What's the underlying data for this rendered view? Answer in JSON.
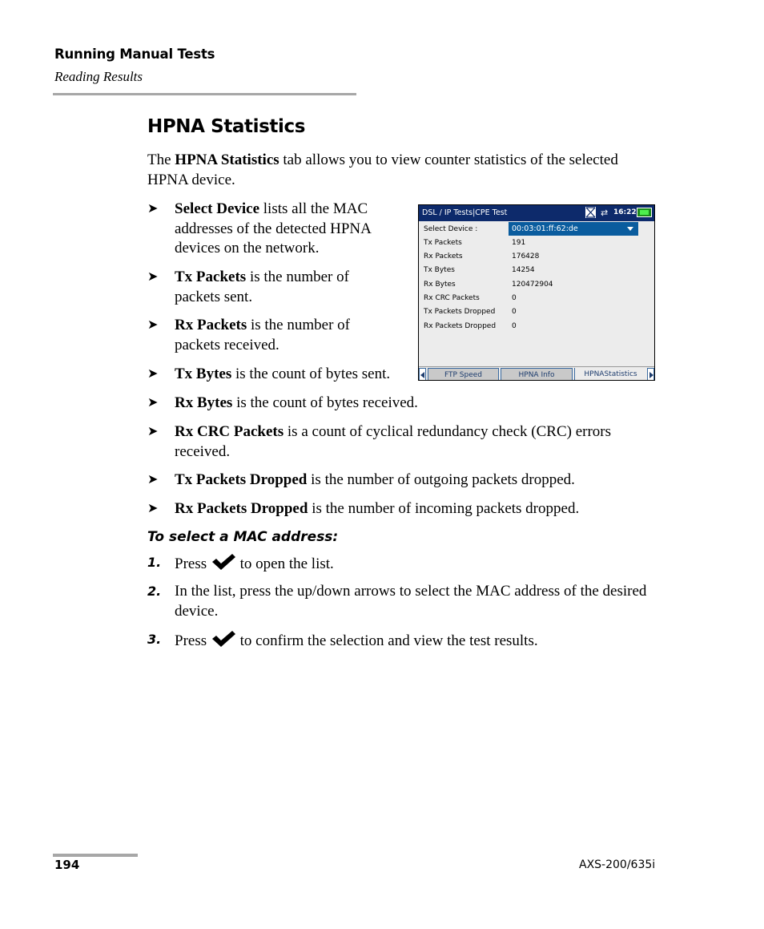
{
  "header": {
    "chapter": "Running Manual Tests",
    "section": "Reading Results"
  },
  "section_title": "HPNA Statistics",
  "intro": {
    "pre": "The ",
    "bold": "HPNA Statistics",
    "post": " tab allows you to view counter statistics of the selected HPNA device."
  },
  "bullets": [
    {
      "term": "Select Device",
      "text": " lists all the MAC addresses of the detected HPNA devices on the network."
    },
    {
      "term": "Tx Packets",
      "text": " is the number of packets sent."
    },
    {
      "term": "Rx Packets",
      "text": " is the number of packets received."
    },
    {
      "term": "Tx Bytes",
      "text": " is the count of bytes sent."
    },
    {
      "term": "Rx Bytes",
      "text": " is the count of bytes received."
    },
    {
      "term": "Rx CRC Packets",
      "text": " is a count of cyclical redundancy check (CRC) errors received."
    },
    {
      "term": "Tx Packets Dropped",
      "text": " is the number of outgoing packets dropped."
    },
    {
      "term": "Rx Packets Dropped",
      "text": " is the number of incoming packets dropped."
    }
  ],
  "bullet_glyph": "➤",
  "procedure": {
    "title": "To select a MAC address:",
    "steps": [
      {
        "num": "1.",
        "pre": "Press ",
        "icon": "checkmark-icon",
        "post": " to open the list."
      },
      {
        "num": "2.",
        "text": "In the list, press the up/down arrows to select the MAC address of the desired device."
      },
      {
        "num": "3.",
        "pre": "Press ",
        "icon": "checkmark-icon",
        "post": " to confirm the selection and view the test results."
      }
    ]
  },
  "device": {
    "title": "DSL / IP Tests|CPE Test",
    "time": "16:22",
    "select_label": "Select Device :",
    "selected_mac": "00:03:01:ff:62:de",
    "rows": [
      {
        "label": "Tx Packets",
        "value": "191"
      },
      {
        "label": "Rx Packets",
        "value": "176428"
      },
      {
        "label": "Tx Bytes",
        "value": "14254"
      },
      {
        "label": "Rx Bytes",
        "value": "120472904"
      },
      {
        "label": "Rx CRC Packets",
        "value": "0"
      },
      {
        "label": "Tx Packets Dropped",
        "value": "0"
      },
      {
        "label": "Rx Packets Dropped",
        "value": "0"
      }
    ],
    "tabs": [
      {
        "label": "FTP Speed",
        "active": false
      },
      {
        "label": "HPNA Info",
        "active": false
      },
      {
        "label": "HPNAStatistics",
        "active": true
      }
    ],
    "colors": {
      "title_bar": "#0d2a6b",
      "select_bg": "#0a5c9e",
      "panel_bg": "#ececec"
    }
  },
  "footer": {
    "page_number": "194",
    "model": "AXS-200/635i"
  }
}
